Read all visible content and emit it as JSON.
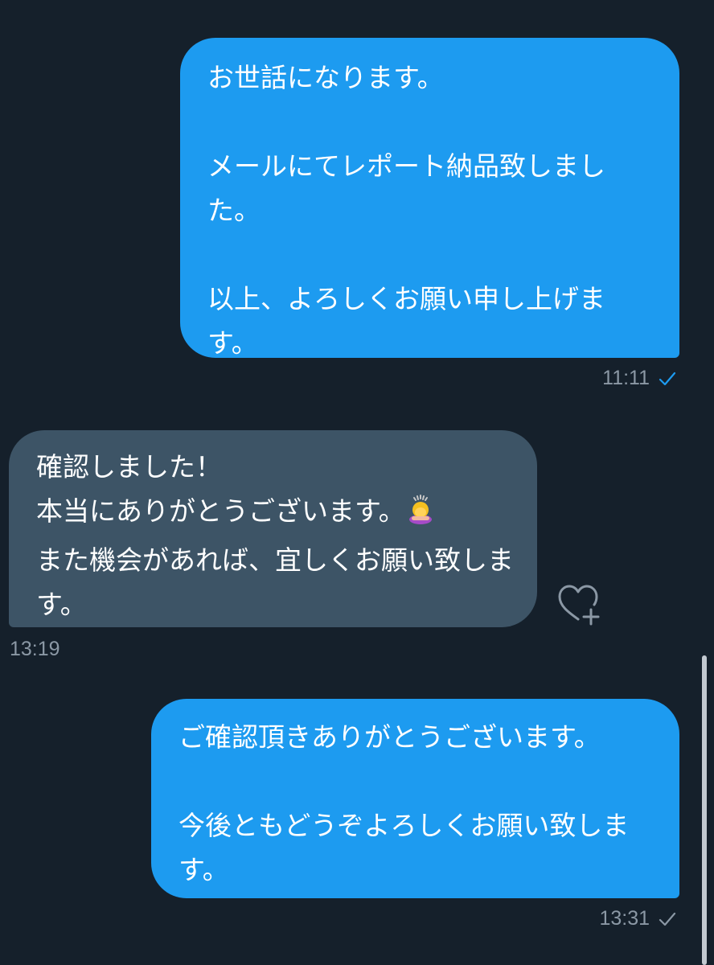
{
  "messages": [
    {
      "direction": "sent",
      "text": "お世話になります。\n\nメールにてレポート納品致しました。\n\n以上、よろしくお願い申し上げます。",
      "time": "11:11",
      "status_icon": "read-check-icon",
      "status_color": "#1d9bf0"
    },
    {
      "direction": "received",
      "text_lines": [
        "確認しました！",
        "本当にありがとうございます。",
        "また機会があれば、宜しくお願い致します。"
      ],
      "emoji": "person-bowing-icon",
      "time": "13:19",
      "reaction_icon": "heart-add-icon"
    },
    {
      "direction": "sent",
      "text": "ご確認頂きありがとうございます。\n\n今後ともどうぞよろしくお願い致します。",
      "time": "13:31",
      "status_icon": "sent-check-icon",
      "status_color": "#8b98a5"
    }
  ],
  "colors": {
    "background": "#15202b",
    "sent_bubble": "#1d9bf0",
    "received_bubble": "#3d5466",
    "meta_text": "#8b98a5"
  }
}
